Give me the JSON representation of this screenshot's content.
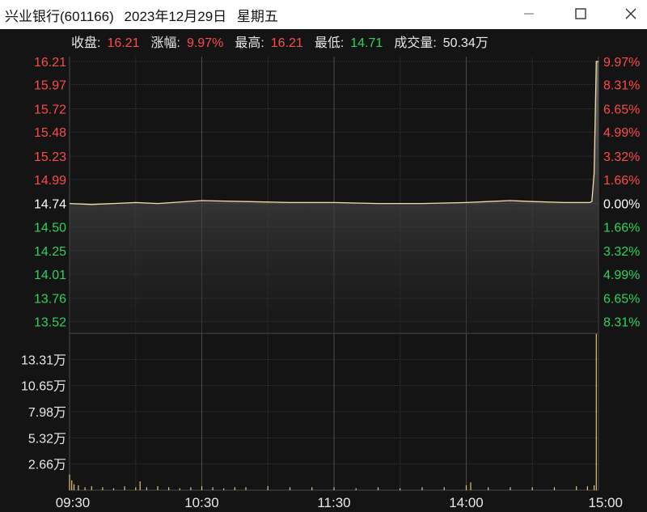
{
  "window": {
    "stock": "兴业银行(601166)",
    "date": "2023年12月29日",
    "weekday": "星期五",
    "min_icon": "minimize-icon",
    "max_icon": "maximize-icon",
    "close_icon": "close-icon"
  },
  "summary": [
    {
      "label": "收盘:",
      "value": "16.21",
      "color": "#ff4a4a"
    },
    {
      "label": "涨幅:",
      "value": "9.97%",
      "color": "#ff4a4a"
    },
    {
      "label": "最高:",
      "value": "16.21",
      "color": "#ff4a4a"
    },
    {
      "label": "最低:",
      "value": "14.71",
      "color": "#2ed35e"
    },
    {
      "label": "成交量:",
      "value": "50.34万",
      "color": "#e8e8e8"
    }
  ],
  "colors": {
    "up": "#ff4a4a",
    "down": "#2ed35e",
    "neutral": "#ffffff",
    "price_line": "#f2dfa6",
    "volume_bar": "#e3c47a",
    "grid": "#3a3a3a"
  },
  "chart_data": {
    "type": "line",
    "prev_close": 14.74,
    "price_ticks": [
      {
        "label": "16.21",
        "value": 16.21,
        "side": "up"
      },
      {
        "label": "15.97",
        "value": 15.97,
        "side": "up"
      },
      {
        "label": "15.72",
        "value": 15.72,
        "side": "up"
      },
      {
        "label": "15.48",
        "value": 15.48,
        "side": "up"
      },
      {
        "label": "15.23",
        "value": 15.23,
        "side": "up"
      },
      {
        "label": "14.99",
        "value": 14.99,
        "side": "up"
      },
      {
        "label": "14.74",
        "value": 14.74,
        "side": "flat"
      },
      {
        "label": "14.50",
        "value": 14.5,
        "side": "down"
      },
      {
        "label": "14.25",
        "value": 14.25,
        "side": "down"
      },
      {
        "label": "14.01",
        "value": 14.01,
        "side": "down"
      },
      {
        "label": "13.76",
        "value": 13.76,
        "side": "down"
      },
      {
        "label": "13.52",
        "value": 13.52,
        "side": "down"
      }
    ],
    "pct_ticks": [
      {
        "label": "9.97%",
        "side": "up"
      },
      {
        "label": "8.31%",
        "side": "up"
      },
      {
        "label": "6.65%",
        "side": "up"
      },
      {
        "label": "4.99%",
        "side": "up"
      },
      {
        "label": "3.32%",
        "side": "up"
      },
      {
        "label": "1.66%",
        "side": "up"
      },
      {
        "label": "0.00%",
        "side": "flat"
      },
      {
        "label": "1.66%",
        "side": "down"
      },
      {
        "label": "3.32%",
        "side": "down"
      },
      {
        "label": "4.99%",
        "side": "down"
      },
      {
        "label": "6.65%",
        "side": "down"
      },
      {
        "label": "8.31%",
        "side": "down"
      }
    ],
    "volume_ticks": [
      {
        "label": "13.31万",
        "value": 13.31
      },
      {
        "label": "10.65万",
        "value": 10.65
      },
      {
        "label": "7.98万",
        "value": 7.98
      },
      {
        "label": "5.32万",
        "value": 5.32
      },
      {
        "label": "2.66万",
        "value": 2.66
      }
    ],
    "volume_max": 15.97,
    "time_ticks": [
      {
        "label": "09:30",
        "minute": 0
      },
      {
        "label": "10:30",
        "minute": 60
      },
      {
        "label": "11:30",
        "minute": 120
      },
      {
        "label": "14:00",
        "minute": 180
      },
      {
        "label": "15:00",
        "minute": 240
      }
    ],
    "total_minutes": 240,
    "price_series": [
      [
        0,
        14.74
      ],
      [
        10,
        14.73
      ],
      [
        20,
        14.74
      ],
      [
        30,
        14.75
      ],
      [
        40,
        14.74
      ],
      [
        60,
        14.77
      ],
      [
        80,
        14.76
      ],
      [
        100,
        14.75
      ],
      [
        120,
        14.75
      ],
      [
        140,
        14.74
      ],
      [
        160,
        14.74
      ],
      [
        180,
        14.75
      ],
      [
        190,
        14.76
      ],
      [
        200,
        14.77
      ],
      [
        210,
        14.76
      ],
      [
        225,
        14.75
      ],
      [
        236,
        14.75
      ],
      [
        237,
        14.76
      ],
      [
        238,
        15.05
      ],
      [
        239,
        16.21
      ],
      [
        240,
        16.21
      ]
    ],
    "volume_series": [
      [
        0,
        1.6
      ],
      [
        1,
        1.0
      ],
      [
        2,
        0.6
      ],
      [
        4,
        0.5
      ],
      [
        7,
        0.3
      ],
      [
        10,
        0.4
      ],
      [
        15,
        0.3
      ],
      [
        20,
        0.2
      ],
      [
        25,
        0.4
      ],
      [
        30,
        0.3
      ],
      [
        32,
        0.9
      ],
      [
        35,
        0.3
      ],
      [
        40,
        0.4
      ],
      [
        45,
        0.3
      ],
      [
        50,
        0.2
      ],
      [
        55,
        0.3
      ],
      [
        60,
        0.4
      ],
      [
        65,
        0.3
      ],
      [
        70,
        0.2
      ],
      [
        75,
        0.3
      ],
      [
        80,
        0.3
      ],
      [
        90,
        0.4
      ],
      [
        100,
        0.3
      ],
      [
        110,
        0.3
      ],
      [
        120,
        0.3
      ],
      [
        130,
        0.2
      ],
      [
        140,
        0.3
      ],
      [
        150,
        0.2
      ],
      [
        160,
        0.3
      ],
      [
        170,
        0.3
      ],
      [
        180,
        0.5
      ],
      [
        182,
        0.8
      ],
      [
        190,
        0.3
      ],
      [
        200,
        0.3
      ],
      [
        210,
        0.3
      ],
      [
        220,
        0.3
      ],
      [
        230,
        0.4
      ],
      [
        235,
        0.4
      ],
      [
        238,
        0.5
      ],
      [
        239,
        15.9
      ]
    ]
  }
}
